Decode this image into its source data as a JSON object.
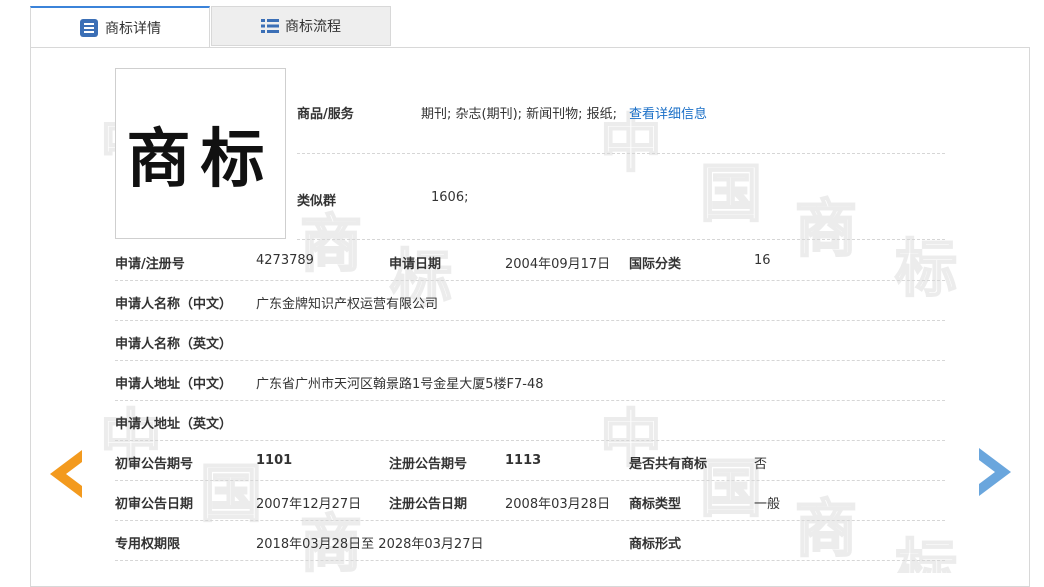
{
  "tabs": [
    {
      "label": "商标详情",
      "icon": "list-box-icon",
      "active": true
    },
    {
      "label": "商标流程",
      "icon": "list-icon",
      "active": false
    }
  ],
  "trademark_image": {
    "text": "商标"
  },
  "goods_services": {
    "label": "商品/服务",
    "value": "期刊; 杂志(期刊); 新闻刊物; 报纸;",
    "link": "查看详细信息"
  },
  "similar_group": {
    "label": "类似群",
    "value": "1606;"
  },
  "reg_no": {
    "label": "申请/注册号",
    "value": "4273789"
  },
  "apply_date": {
    "label": "申请日期",
    "value": "2004年09月17日"
  },
  "intl_class": {
    "label": "国际分类",
    "value": "16"
  },
  "applicant_cn": {
    "label": "申请人名称（中文）",
    "value": "广东金牌知识产权运营有限公司"
  },
  "applicant_en": {
    "label": "申请人名称（英文）",
    "value": ""
  },
  "address_cn": {
    "label": "申请人地址（中文）",
    "value": "广东省广州市天河区翰景路1号金星大厦5楼F7-48"
  },
  "address_en": {
    "label": "申请人地址（英文）",
    "value": ""
  },
  "prelim_issue": {
    "label": "初审公告期号",
    "value": "1101"
  },
  "reg_issue": {
    "label": "注册公告期号",
    "value": "1113"
  },
  "shared": {
    "label": "是否共有商标",
    "value": "否"
  },
  "prelim_date": {
    "label": "初审公告日期",
    "value": "2007年12月27日"
  },
  "reg_date": {
    "label": "注册公告日期",
    "value": "2008年03月28日"
  },
  "tm_type": {
    "label": "商标类型",
    "value": "一般"
  },
  "exclusive_period": {
    "label": "专用权期限",
    "value": "2018年03月28日至 2028年03月27日"
  },
  "tm_form": {
    "label": "商标形式",
    "value": ""
  },
  "watermark": {
    "chars": [
      "中",
      "国",
      "商",
      "标"
    ]
  },
  "colors": {
    "accent": "#3b83d9",
    "link": "#1a6fc7",
    "prev_arrow": "#f39a1e",
    "next_arrow": "#6aa6dd"
  }
}
